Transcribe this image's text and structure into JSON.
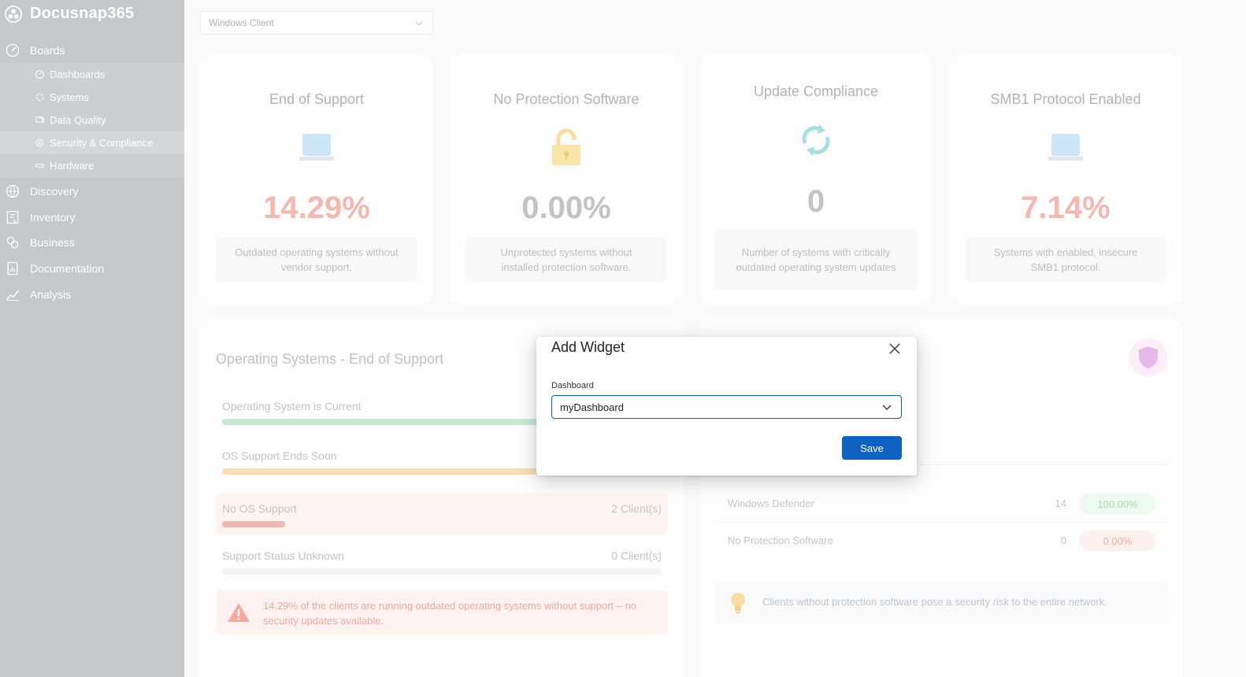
{
  "app": {
    "title": "Docusnap365"
  },
  "sidebar": {
    "boards": {
      "label": "Boards",
      "items": [
        {
          "label": "Dashboards",
          "icon": "dashboard-icon"
        },
        {
          "label": "Systems",
          "icon": "systems-icon"
        },
        {
          "label": "Data Quality",
          "icon": "data-quality-icon"
        },
        {
          "label": "Security & Compliance",
          "icon": "security-icon",
          "active": true
        },
        {
          "label": "Hardware",
          "icon": "hardware-icon"
        }
      ]
    },
    "groups": [
      {
        "label": "Discovery",
        "icon": "discovery-icon"
      },
      {
        "label": "Inventory",
        "icon": "inventory-icon"
      },
      {
        "label": "Business",
        "icon": "business-icon"
      },
      {
        "label": "Documentation",
        "icon": "documentation-icon"
      },
      {
        "label": "Analysis",
        "icon": "analysis-icon"
      }
    ]
  },
  "filter": {
    "client_type": "Windows Client"
  },
  "kpis": [
    {
      "title": "End of Support",
      "value": "14.29%",
      "description": "Outdated operating systems without vendor support.",
      "icon": "laptop-icon",
      "color": "#f2b8b1"
    },
    {
      "title": "No Protection Software",
      "value": "0.00%",
      "description": "Unprotected systems without installed protection software.",
      "icon": "unlocked-padlock-icon",
      "color": "#c3c3c3"
    },
    {
      "title": "Update Compliance",
      "value": "0",
      "description": "Number of systems with critically outdated operating system updates",
      "icon": "refresh-icon",
      "color": "#c3c3c3"
    },
    {
      "title": "SMB1 Protocol Enabled",
      "value": "7.14%",
      "description": "Systems with enabled, insecure SMB1 protocol.",
      "icon": "laptop-icon",
      "color": "#f2b8b1"
    }
  ],
  "os_support": {
    "title": "Operating Systems - End of Support",
    "rows": [
      {
        "label": "Operating System is Current",
        "count": "",
        "fill": 0.85,
        "color": "#c9e8d4"
      },
      {
        "label": "OS Support Ends Soon",
        "count": "",
        "fill": 0.85,
        "color": "#f8dfb4"
      },
      {
        "label": "No OS Support",
        "count": "2 Client(s)",
        "fill": 0.143,
        "color": "#f0b8b3"
      },
      {
        "label": "Support Status Unknown",
        "count": "0 Client(s)",
        "fill": 0.0,
        "color": "#e6e6e6"
      }
    ],
    "alert": "14.29% of the clients are running outdated operating systems without support – no security updates available."
  },
  "protection": {
    "rows": [
      {
        "name": "Windows Defender",
        "count": "14",
        "percent": "100.00%",
        "pill_bg": "#eef9f1",
        "pill_fg": "#a6dcb6"
      },
      {
        "name": "No Protection Software",
        "count": "0",
        "percent": "0.00%",
        "pill_bg": "#fdf1ef",
        "pill_fg": "#f2aaa2"
      }
    ],
    "tip": "Clients without protection software pose a security risk to the entire network."
  },
  "modal": {
    "title": "Add Widget",
    "field_label": "Dashboard",
    "selected": "myDashboard",
    "save_label": "Save"
  }
}
